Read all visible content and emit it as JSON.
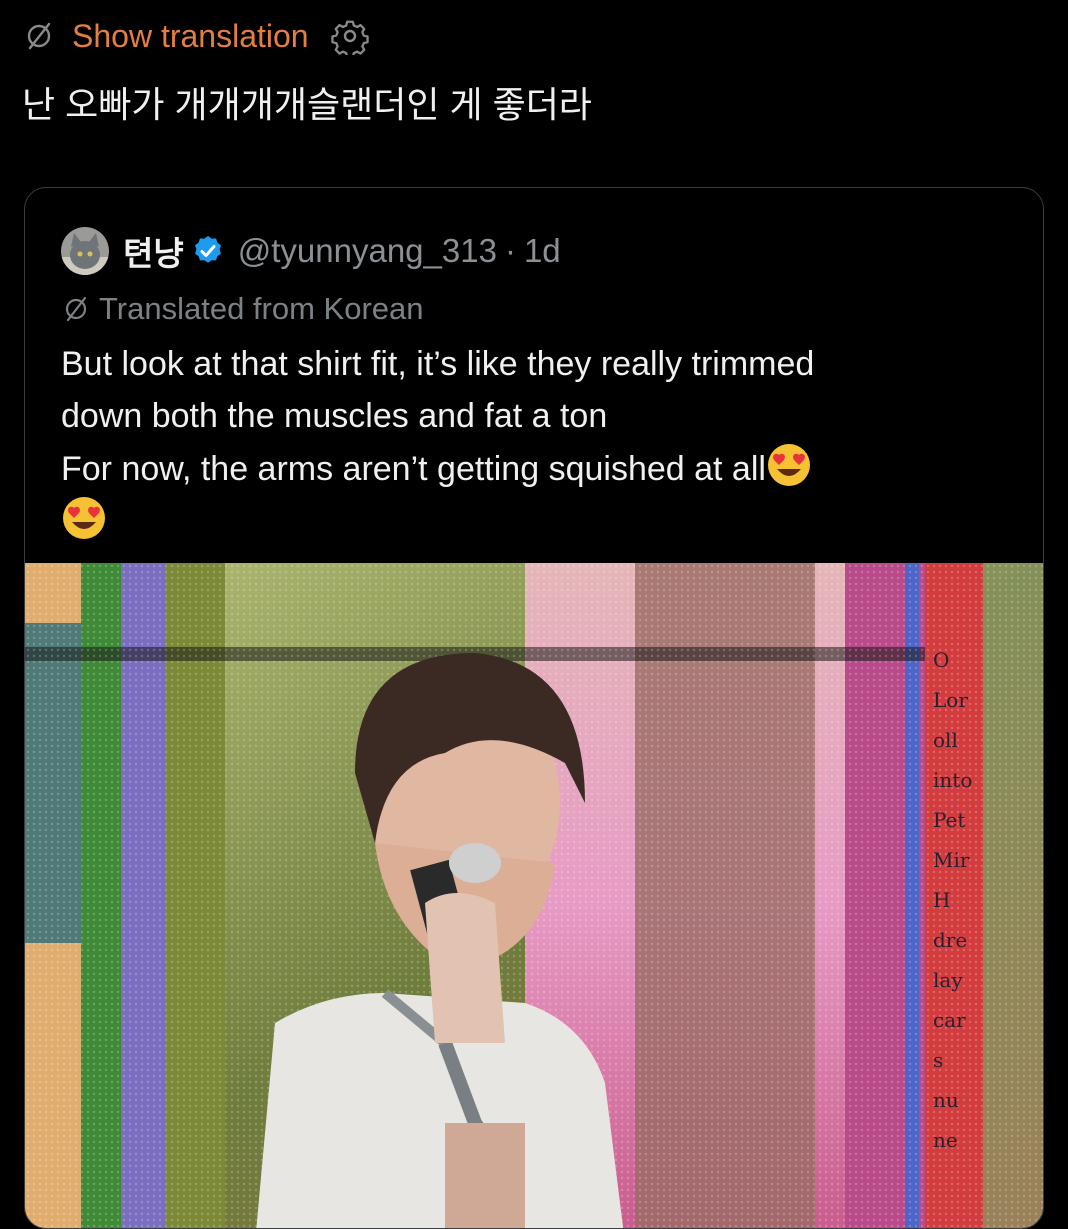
{
  "top": {
    "show_translation": "Show translation",
    "icons": [
      "translate-off-icon",
      "gear-icon"
    ]
  },
  "post": {
    "text": "난 오빠가 개개개개슬랜더인 게 좋더라"
  },
  "quote": {
    "name": "텬냥",
    "handle": "@tyunnyang_313",
    "separator": "·",
    "time": "1d",
    "translated_from": "Translated from Korean",
    "lines": [
      "But look at that shirt fit, it’s like they really trimmed",
      "down both the muscles and fat a ton",
      "For now, the arms aren’t getting squished at all"
    ],
    "icons": [
      "avatar-cat",
      "verified-badge-icon",
      "heart-eyes-emoji"
    ],
    "media_overlay_text": [
      "O",
      "Lor",
      "oll",
      "into",
      "Pet",
      "Mir",
      "H",
      "dre",
      "lay",
      "car",
      "s",
      "nu",
      "ne"
    ]
  },
  "colors": {
    "background": "#000000",
    "link_orange": "#e47f41",
    "verified_blue": "#1d9bf0",
    "muted": "#8b9095"
  }
}
